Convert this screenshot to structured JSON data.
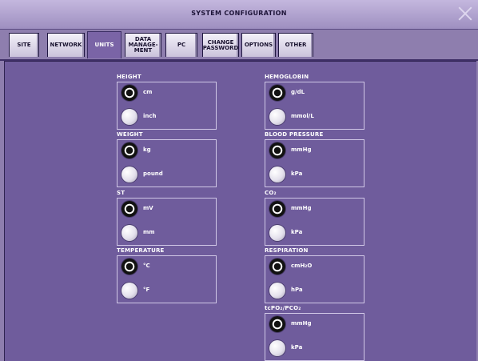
{
  "window": {
    "title": "SYSTEM CONFIGURATION"
  },
  "tabs": [
    {
      "label": "SITE",
      "active": false
    },
    {
      "label": "NETWORK",
      "active": false
    },
    {
      "label": "UNITS",
      "active": true
    },
    {
      "label": "DATA\nMANAGE-\nMENT",
      "active": false
    },
    {
      "label": "PC",
      "active": false
    },
    {
      "label": "CHANGE\nPASSWORD",
      "active": false
    },
    {
      "label": "OPTIONS",
      "active": false
    },
    {
      "label": "OTHER",
      "active": false
    }
  ],
  "groups": [
    {
      "title": "HEIGHT",
      "options": [
        "cm",
        "inch"
      ],
      "selected": "cm"
    },
    {
      "title": "WEIGHT",
      "options": [
        "kg",
        "pound"
      ],
      "selected": "kg"
    },
    {
      "title": "ST",
      "options": [
        "mV",
        "mm"
      ],
      "selected": "mV"
    },
    {
      "title": "TEMPERATURE",
      "options": [
        "°C",
        "°F"
      ],
      "selected": "°C"
    },
    {
      "title": "HEMOGLOBIN",
      "options": [
        "g/dL",
        "mmol/L"
      ],
      "selected": "g/dL"
    },
    {
      "title": "BLOOD PRESSURE",
      "options": [
        "mmHg",
        "kPa"
      ],
      "selected": "mmHg"
    },
    {
      "title": "CO₂",
      "options": [
        "mmHg",
        "kPa"
      ],
      "selected": "mmHg"
    },
    {
      "title": "RESPIRATION",
      "options": [
        "cmH₂O",
        "hPa"
      ],
      "selected": "cmH₂O"
    },
    {
      "title": "tcPO₂/PCO₂",
      "options": [
        "mmHg",
        "kPa"
      ],
      "selected": "mmHg"
    }
  ]
}
